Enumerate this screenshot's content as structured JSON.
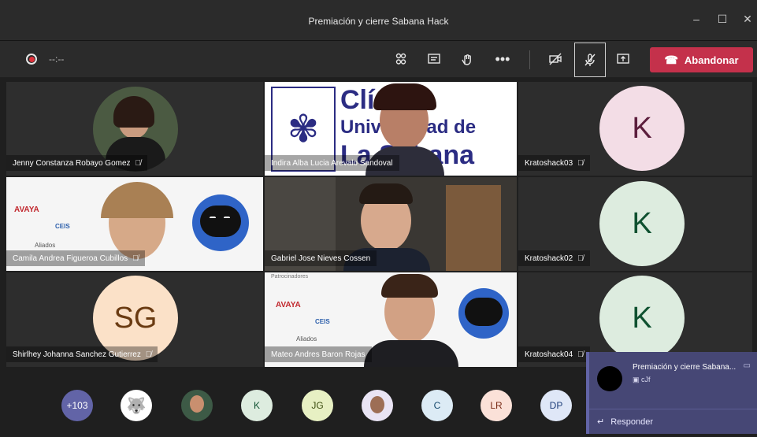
{
  "window": {
    "title": "Premiación y cierre Sabana Hack"
  },
  "toolbar": {
    "timer": "--:--",
    "leave_label": "Abandonar"
  },
  "tiles": [
    {
      "name": "Jenny Constanza Robayo Gomez"
    },
    {
      "name": "Indira Alba Lucia Arevalo Sandoval"
    },
    {
      "name": "Kratoshack03",
      "initial": "K"
    },
    {
      "name": "Camila Andrea Figueroa Cubillos"
    },
    {
      "name": "Gabriel Jose Nieves Cossen"
    },
    {
      "name": "Kratoshack02",
      "initial": "K"
    },
    {
      "name": "Shirlhey Johanna Sanchez Gutierrez",
      "initial": "SG"
    },
    {
      "name": "Mateo Andres Baron Rojas"
    },
    {
      "name": "Kratoshack04",
      "initial": "K"
    }
  ],
  "logo": {
    "line1": "Clínica",
    "line2": "Universidad de",
    "line3": "La Sabana"
  },
  "sponsors": {
    "avaya": "AVAYA",
    "ceis": "CEIS",
    "aliados": "Aliados",
    "patrocinadores": "Patrocinadores"
  },
  "participants_bar": {
    "overflow": "+103",
    "items": [
      {
        "label": "K"
      },
      {
        "label": "JG"
      },
      {
        "label": "C"
      },
      {
        "label": "LR"
      },
      {
        "label": "DP"
      }
    ]
  },
  "notification": {
    "title": "Premiación y cierre Sabana...",
    "subtitle": "cJf",
    "reply_label": "Responder"
  },
  "colors": {
    "leave": "#c4314b",
    "notification": "#464775",
    "avatar_k": "#ddecdf",
    "avatar_sg": "#fbe1c8"
  }
}
